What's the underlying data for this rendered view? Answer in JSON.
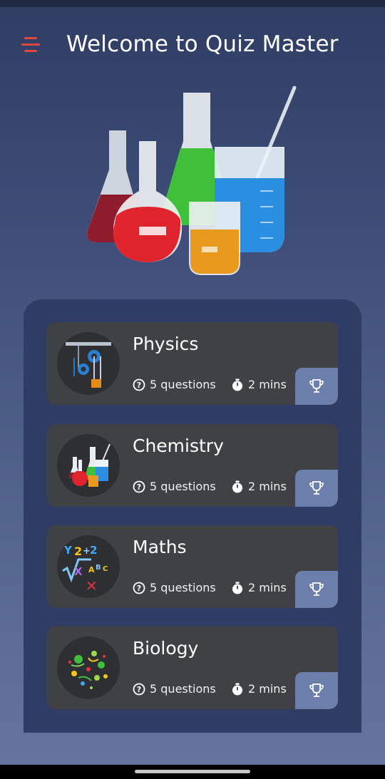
{
  "header": {
    "title": "Welcome to Quiz Master",
    "menu_icon": "hamburger-menu-icon",
    "accent_color": "#e0463e"
  },
  "hero": {
    "image": "laboratory-glassware-illustration"
  },
  "quizzes": [
    {
      "title": "Physics",
      "questions": "5 questions",
      "duration": "2 mins",
      "icon": "pulley-icon"
    },
    {
      "title": "Chemistry",
      "questions": "5 questions",
      "duration": "2 mins",
      "icon": "flasks-icon"
    },
    {
      "title": "Maths",
      "questions": "5 questions",
      "duration": "2 mins",
      "icon": "math-symbols-icon"
    },
    {
      "title": "Biology",
      "questions": "5 questions",
      "duration": "2 mins",
      "icon": "microbes-icon"
    }
  ],
  "colors": {
    "panel": "#2f3c63",
    "card": "#404144",
    "trophy_button": "#6c7eaa"
  }
}
